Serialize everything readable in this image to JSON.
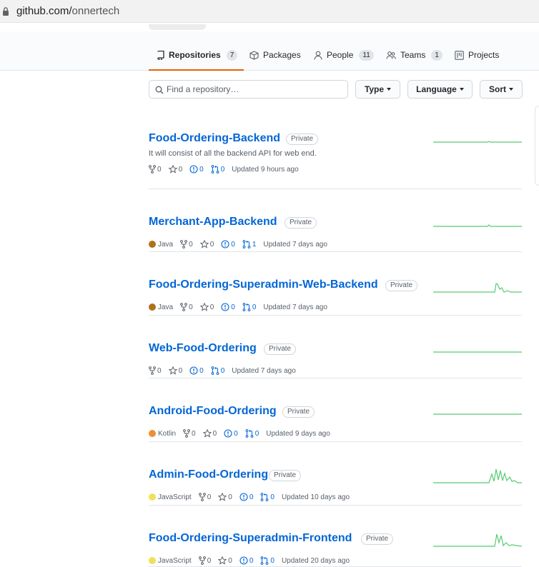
{
  "browser": {
    "url_host": "github.com/",
    "url_path": "onnertech"
  },
  "tabs": [
    {
      "label": "Repositories",
      "count": "7"
    },
    {
      "label": "Packages",
      "count": ""
    },
    {
      "label": "People",
      "count": "11"
    },
    {
      "label": "Teams",
      "count": "1"
    },
    {
      "label": "Projects",
      "count": ""
    }
  ],
  "filter": {
    "search_placeholder": "Find a repository…",
    "type_label": "Type",
    "language_label": "Language",
    "sort_label": "Sort"
  },
  "colors": {
    "link": "#0366d6",
    "tab_underline": "#e36209",
    "java": "#b07219",
    "kotlin": "#F18E33",
    "javascript": "#f1e05a",
    "spark": "#2cbe4e"
  },
  "repos": [
    {
      "name": "Food-Ordering-Backend",
      "visibility": "Private",
      "description": "It will consist of all the backend API for web end.",
      "language": "",
      "forks": "0",
      "stars": "0",
      "issues": "0",
      "pulls": "0",
      "updated": "Updated 9 hours ago"
    },
    {
      "name": "Merchant-App-Backend",
      "visibility": "Private",
      "description": "",
      "language": "Java",
      "forks": "0",
      "stars": "0",
      "issues": "0",
      "pulls": "1",
      "updated": "Updated 7 days ago"
    },
    {
      "name": "Food-Ordering-Superadmin-Web-Backend",
      "visibility": "Private",
      "description": "",
      "language": "Java",
      "forks": "0",
      "stars": "0",
      "issues": "0",
      "pulls": "0",
      "updated": "Updated 7 days ago"
    },
    {
      "name": "Web-Food-Ordering",
      "visibility": "Private",
      "description": "",
      "language": "",
      "forks": "0",
      "stars": "0",
      "issues": "0",
      "pulls": "0",
      "updated": "Updated 7 days ago"
    },
    {
      "name": "Android-Food-Ordering",
      "visibility": "Private",
      "description": "",
      "language": "Kotlin",
      "forks": "0",
      "stars": "0",
      "issues": "0",
      "pulls": "0",
      "updated": "Updated 9 days ago"
    },
    {
      "name": "Admin-Food-Ordering",
      "visibility": "Private",
      "description": "",
      "language": "JavaScript",
      "forks": "0",
      "stars": "0",
      "issues": "0",
      "pulls": "0",
      "updated": "Updated 10 days ago"
    },
    {
      "name": "Food-Ordering-Superadmin-Frontend",
      "visibility": "Private",
      "description": "",
      "language": "JavaScript",
      "forks": "0",
      "stars": "0",
      "issues": "0",
      "pulls": "0",
      "updated": "Updated 20 days ago"
    }
  ]
}
